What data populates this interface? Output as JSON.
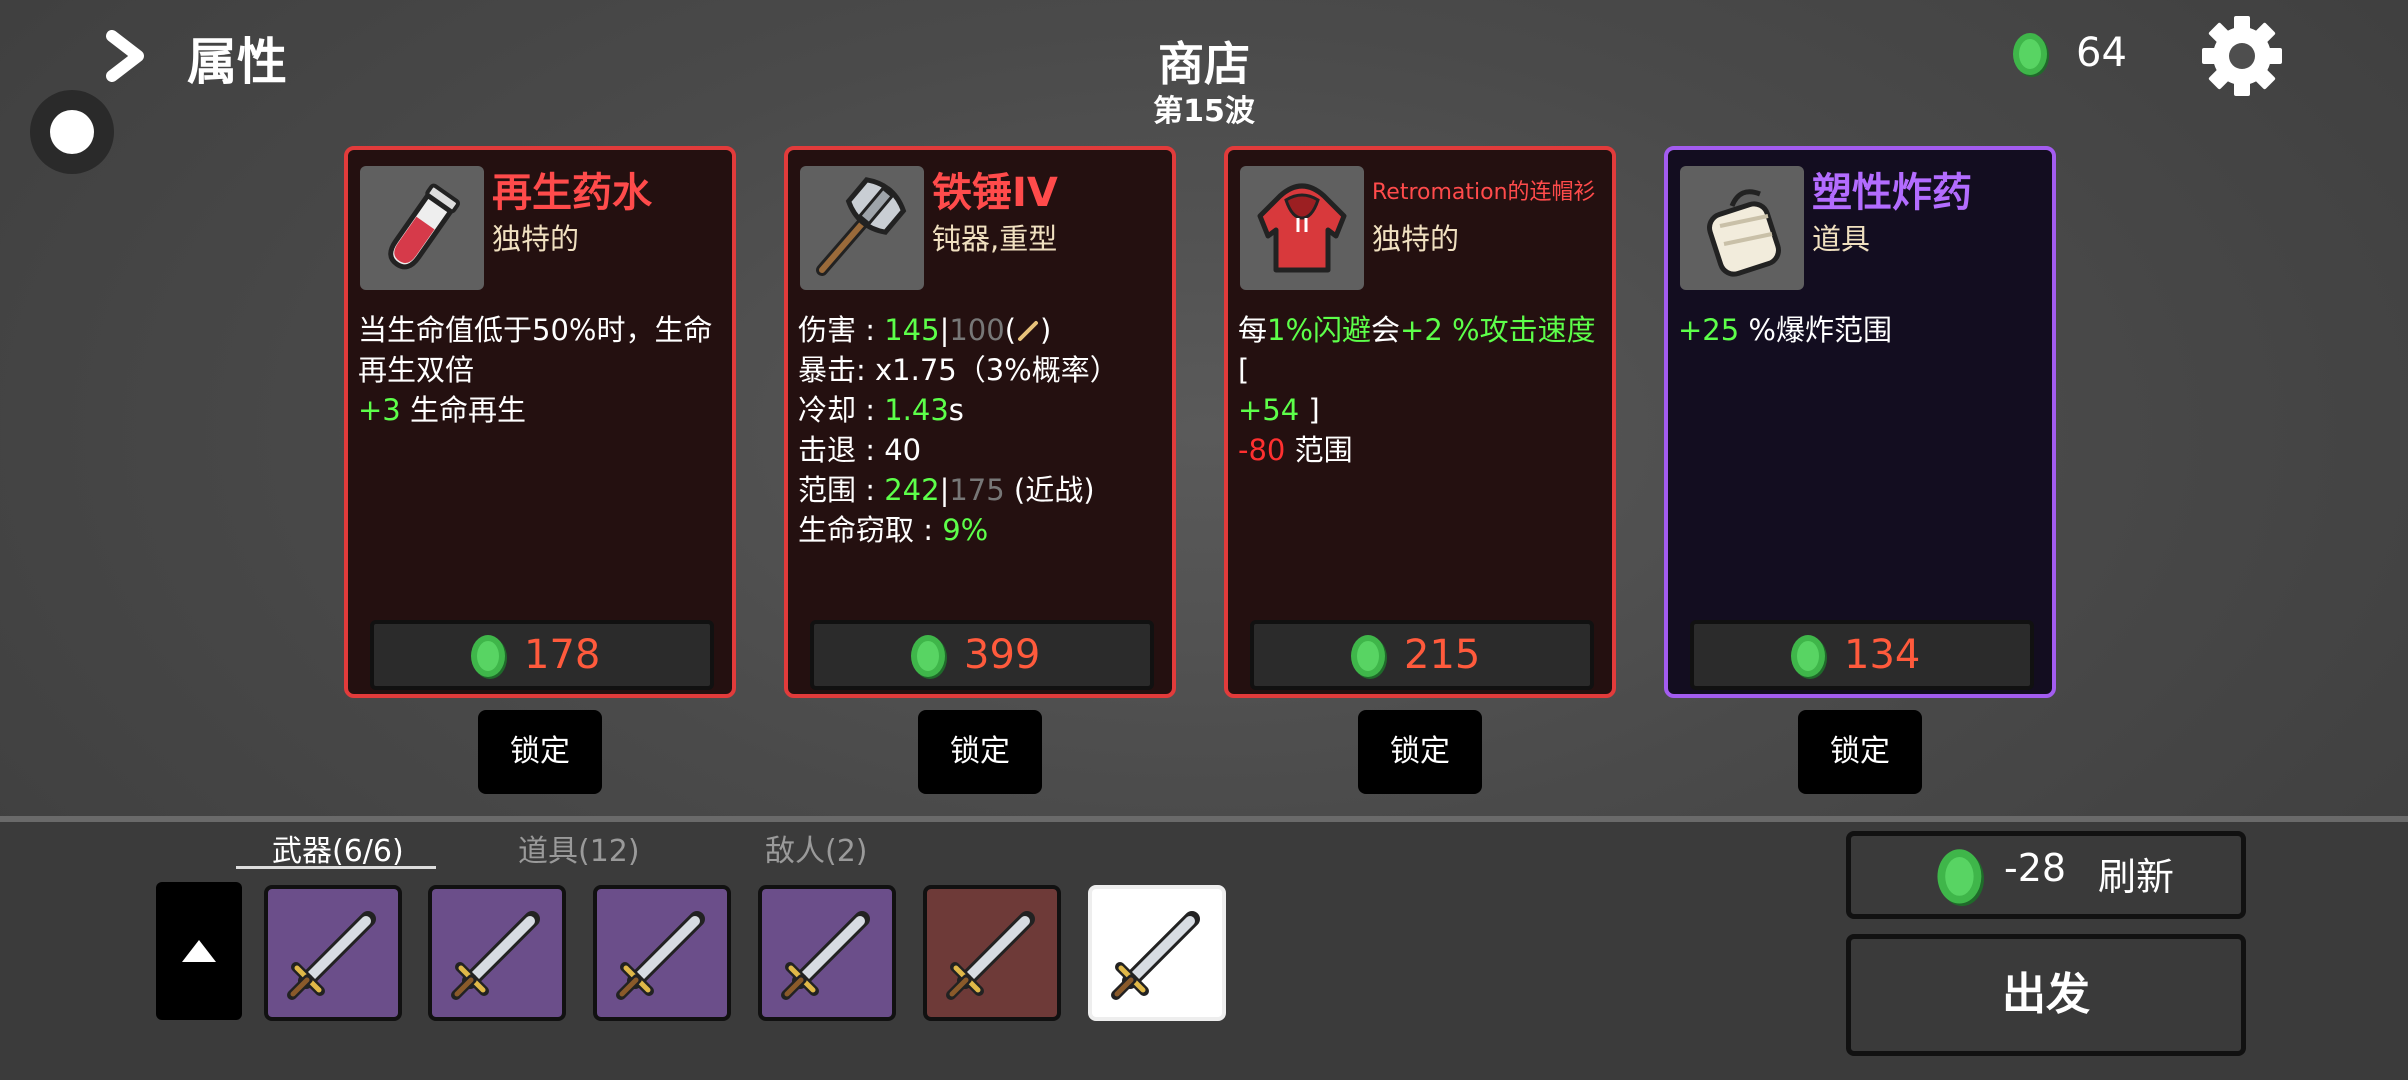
{
  "header": {
    "attributes_label": "属性",
    "shop_title": "商店",
    "wave_label": "第15波",
    "currency": "64"
  },
  "shop": {
    "cards": [
      {
        "name": "再生药水",
        "type": "独特的",
        "desc_line1": "当生命值低于50%时，生命",
        "desc_line2": "再生双倍",
        "stat_value": "+3",
        "stat_label": " 生命再生",
        "price": "178",
        "lock": "锁定",
        "icon": "potion-icon"
      },
      {
        "name": "铁锤IV",
        "type": "钝器,重型",
        "damage_label": "伤害 : ",
        "damage_value": "145",
        "damage_sep": "|",
        "damage_base": "100",
        "damage_suffix": "(",
        "damage_close": ")",
        "crit": "暴击:  x1.75（3%概率）",
        "cooldown_label": "冷却 : ",
        "cooldown_value": "1.43",
        "cooldown_unit": "s",
        "knockback": "击退 : 40",
        "range_label": "范围 : ",
        "range_value": "242",
        "range_sep": "|",
        "range_base": "175",
        "range_note": " (近战)",
        "lifesteal_label": "生命窃取 : ",
        "lifesteal_value": "9%",
        "price": "399",
        "lock": "锁定",
        "icon": "hammer-icon"
      },
      {
        "name": "Retromation的连帽衫",
        "type": "独特的",
        "line1_prefix": "每",
        "line1_g1": "1%闪避",
        "line1_mid": "会",
        "line1_g2": "+2 %攻击速度",
        "line1_suffix": " [",
        "line2_g": "+54",
        "line2_suffix": " ]",
        "line3_r": "-80",
        "line3_suffix": " 范围",
        "price": "215",
        "lock": "锁定",
        "icon": "hoodie-icon"
      },
      {
        "name": "塑性炸药",
        "type": "道具",
        "stat_value": "+25",
        "stat_label": " %爆炸范围",
        "price": "134",
        "lock": "锁定",
        "icon": "explosive-icon"
      }
    ]
  },
  "inventory": {
    "tabs": [
      "武器(6/6)",
      "道具(12)",
      "敌人(2)"
    ],
    "slots": [
      "sword-icon",
      "sword-icon",
      "sword-icon",
      "sword-icon",
      "sword-icon",
      "sword-icon"
    ]
  },
  "actions": {
    "refresh_cost": "-28",
    "refresh_label": "刷新",
    "go_label": "出发"
  },
  "colors": {
    "rare_border": "#e23b3b",
    "epic_border": "#a35cf0",
    "positive": "#5dff4a",
    "negative": "#ff3030",
    "price": "#ff5a3c"
  }
}
